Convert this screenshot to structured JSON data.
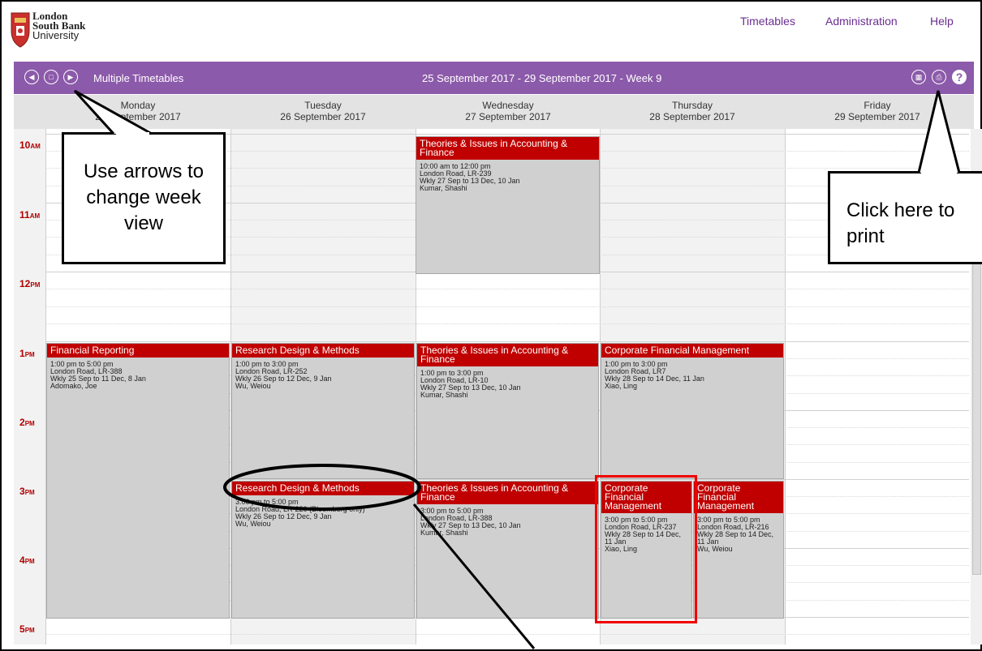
{
  "header": {
    "logo_line1": "London",
    "logo_line2": "South Bank",
    "logo_line3": "University",
    "nav": [
      "Timetables",
      "Administration",
      "Help"
    ]
  },
  "toolbar": {
    "title": "Multiple Timetables",
    "range": "25 September 2017 - 29 September 2017 - Week 9",
    "help_glyph": "?"
  },
  "days": [
    {
      "name": "Monday",
      "date": "25 September 2017"
    },
    {
      "name": "Tuesday",
      "date": "26 September 2017"
    },
    {
      "name": "Wednesday",
      "date": "27 September 2017"
    },
    {
      "name": "Thursday",
      "date": "28 September 2017"
    },
    {
      "name": "Friday",
      "date": "29 September 2017"
    }
  ],
  "hours": [
    {
      "num": "10",
      "suf": "AM"
    },
    {
      "num": "11",
      "suf": "AM"
    },
    {
      "num": "12",
      "suf": "PM"
    },
    {
      "num": "1",
      "suf": "PM"
    },
    {
      "num": "2",
      "suf": "PM"
    },
    {
      "num": "3",
      "suf": "PM"
    },
    {
      "num": "4",
      "suf": "PM"
    },
    {
      "num": "5",
      "suf": "PM"
    }
  ],
  "events": [
    {
      "title": "Theories & Issues in Accounting & Finance",
      "time": "10:00 am to 12:00 pm",
      "room": "London Road, LR-239",
      "weeks": "Wkly 27 Sep to 13 Dec, 10 Jan",
      "staff": "Kumar, Shashi"
    },
    {
      "title": "Financial Reporting",
      "time": "1:00 pm to 5:00 pm",
      "room": "London Road, LR-388",
      "weeks": "Wkly 25 Sep to 11 Dec, 8 Jan",
      "staff": "Adomako, Joe"
    },
    {
      "title": "Research Design & Methods",
      "time": "1:00 pm to 3:00 pm",
      "room": "London Road, LR-252",
      "weeks": "Wkly 26 Sep to 12 Dec, 9 Jan",
      "staff": "Wu, Weiou"
    },
    {
      "title": "Theories & Issues in Accounting & Finance",
      "time": "1:00 pm to 3:00 pm",
      "room": "London Road, LR-10",
      "weeks": "Wkly 27 Sep to 13 Dec, 10 Jan",
      "staff": "Kumar, Shashi"
    },
    {
      "title": "Corporate Financial Management",
      "time": "1:00 pm to 3:00 pm",
      "room": "London Road, LR7",
      "weeks": "Wkly 28 Sep to 14 Dec, 11 Jan",
      "staff": "Xiao, Ling"
    },
    {
      "title": "Research Design & Methods",
      "time": "3:00 pm to 5:00 pm",
      "room": "London Road, LR-220 (Bloomberg only)",
      "weeks": "Wkly 26 Sep to 12 Dec, 9 Jan",
      "staff": "Wu, Weiou"
    },
    {
      "title": "Theories & Issues in Accounting & Finance",
      "time": "3:00 pm to 5:00 pm",
      "room": "London Road, LR-388",
      "weeks": "Wkly 27 Sep to 13 Dec, 10 Jan",
      "staff": "Kumar, Shashi"
    },
    {
      "title": "Corporate Financial Management",
      "time": "3:00 pm to 5:00 pm",
      "room": "London Road, LR-237",
      "weeks": "Wkly 28 Sep to 14 Dec, 11 Jan",
      "staff": "Xiao, Ling"
    },
    {
      "title": "Corporate Financial Management",
      "time": "3:00 pm to 5:00 pm",
      "room": "London Road, LR-216",
      "weeks": "Wkly 28 Sep to 14 Dec, 11 Jan",
      "staff": "Wu, Weiou"
    }
  ],
  "annotations": {
    "arrows_note": "Use arrows to change week view",
    "print_note": "Click here to print"
  },
  "colors": {
    "toolbar": "#8c5aaa",
    "event_title": "#c00000",
    "event_body": "#d0d0d0",
    "nav_link": "#6a2d91"
  }
}
